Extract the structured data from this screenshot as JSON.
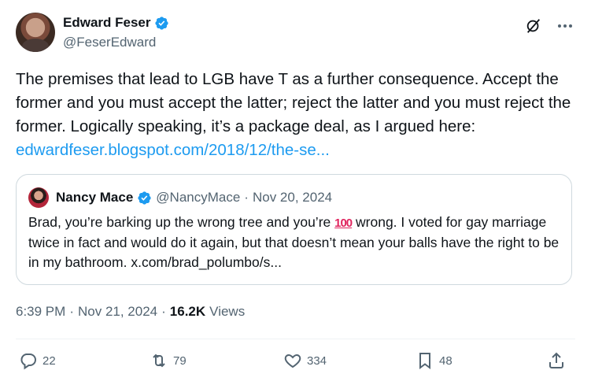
{
  "author": {
    "display_name": "Edward Feser",
    "handle": "@FeserEdward"
  },
  "tweet": {
    "text": "The premises that lead to LGB have T as a further consequence. Accept the former and you must accept the latter; reject the latter and you must reject the former. Logically speaking, it’s a package deal, as I argued here: ",
    "link": "edwardfeser.blogspot.com/2018/12/the-se..."
  },
  "quote": {
    "display_name": "Nancy Mace",
    "handle": "@NancyMace",
    "separator": "·",
    "date": "Nov 20, 2024",
    "text_before": "Brad, you’re barking up the wrong tree and you’re ",
    "emoji": "100",
    "text_after": " wrong. I voted for gay marriage twice in fact and would do it again, but that doesn’t mean your balls have the right to be in my bathroom. x.com/brad_polumbo/s..."
  },
  "meta": {
    "time": "6:39 PM",
    "sep1": "·",
    "date": "Nov 21, 2024",
    "sep2": "·",
    "views_count": "16.2K",
    "views_label": "Views"
  },
  "actions": {
    "replies": "22",
    "reposts": "79",
    "likes": "334",
    "bookmarks": "48"
  },
  "colors": {
    "link": "#1d9bf0",
    "verified": "#1d9bf0",
    "secondary_text": "#536471"
  }
}
